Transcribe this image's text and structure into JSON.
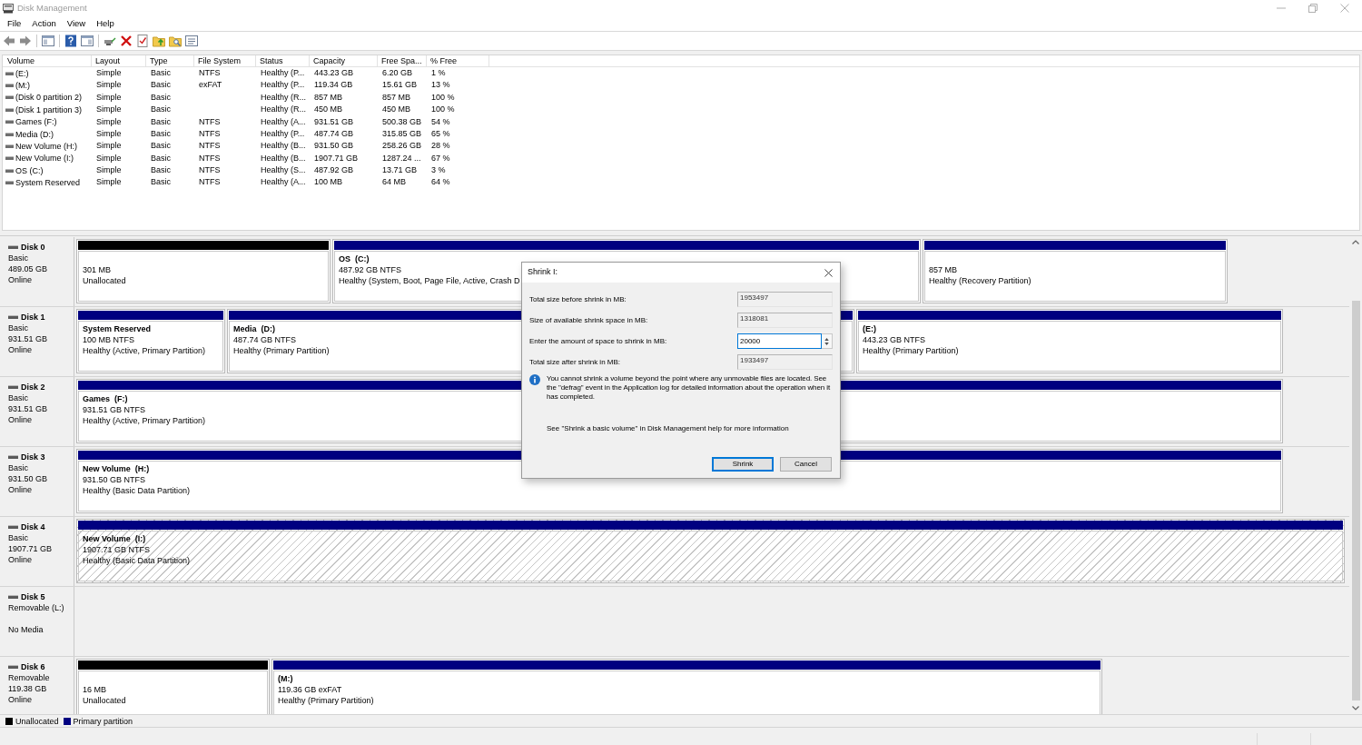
{
  "window": {
    "title": "Disk Management"
  },
  "menu": [
    "File",
    "Action",
    "View",
    "Help"
  ],
  "volume_list": {
    "columns": [
      "Volume",
      "Layout",
      "Type",
      "File System",
      "Status",
      "Capacity",
      "Free Spa...",
      "% Free"
    ],
    "rows": [
      {
        "volume": "(E:)",
        "layout": "Simple",
        "type": "Basic",
        "file_system": "NTFS",
        "status": "Healthy (P...",
        "capacity": "443.23 GB",
        "column_7": "6.20 GB",
        "percent_free": "1 %"
      },
      {
        "volume": "(M:)",
        "layout": "Simple",
        "type": "Basic",
        "file_system": "exFAT",
        "status": "Healthy (P...",
        "capacity": "119.34 GB",
        "column_7": "15.61 GB",
        "percent_free": "13 %"
      },
      {
        "volume": "(Disk 0 partition 2)",
        "layout": "Simple",
        "type": "Basic",
        "status": "Healthy (R...",
        "capacity": "857 MB",
        "column_7": "857 MB",
        "percent_free": "100 %"
      },
      {
        "volume": "(Disk 1 partition 3)",
        "layout": "Simple",
        "type": "Basic",
        "status": "Healthy (R...",
        "capacity": "450 MB",
        "column_7": "450 MB",
        "percent_free": "100 %"
      },
      {
        "volume": "Games (F:)",
        "layout": "Simple",
        "type": "Basic",
        "file_system": "NTFS",
        "status": "Healthy (A...",
        "capacity": "931.51 GB",
        "column_7": "500.38 GB",
        "percent_free": "54 %"
      },
      {
        "volume": "Media (D:)",
        "layout": "Simple",
        "type": "Basic",
        "file_system": "NTFS",
        "status": "Healthy (P...",
        "capacity": "487.74 GB",
        "column_7": "315.85 GB",
        "percent_free": "65 %"
      },
      {
        "volume": "New Volume (H:)",
        "layout": "Simple",
        "type": "Basic",
        "file_system": "NTFS",
        "status": "Healthy (B...",
        "capacity": "931.50 GB",
        "column_7": "258.26 GB",
        "percent_free": "28 %"
      },
      {
        "volume": "New Volume (I:)",
        "layout": "Simple",
        "type": "Basic",
        "file_system": "NTFS",
        "status": "Healthy (B...",
        "capacity": "1907.71 GB",
        "column_7": "1287.24 ...",
        "percent_free": "67 %"
      },
      {
        "volume": "OS (C:)",
        "layout": "Simple",
        "type": "Basic",
        "file_system": "NTFS",
        "status": "Healthy (S...",
        "capacity": "487.92 GB",
        "column_7": "13.71 GB",
        "percent_free": "3 %"
      },
      {
        "volume": "System Reserved",
        "layout": "Simple",
        "type": "Basic",
        "file_system": "NTFS",
        "status": "Healthy (A...",
        "capacity": "100 MB",
        "column_7": "64 MB",
        "percent_free": "64 %"
      }
    ]
  },
  "disks": [
    {
      "name": "Disk 0",
      "type": "Basic",
      "size": "489.05 GB",
      "status": "Online",
      "partitions": [
        {
          "kind": "unallocated",
          "selected": false,
          "size": "301 MB",
          "status": "Unallocated"
        },
        {
          "kind": "primary",
          "selected": false,
          "name": "OS  (C:)",
          "size": "487.92 GB NTFS",
          "status": "Healthy (System, Boot, Page File, Active, Crash D"
        },
        {
          "kind": "primary",
          "selected": false,
          "size": "857 MB",
          "status": "Healthy (Recovery Partition)"
        }
      ]
    },
    {
      "name": "Disk 1",
      "type": "Basic",
      "size": "931.51 GB",
      "status": "Online",
      "partitions": [
        {
          "kind": "primary",
          "selected": false,
          "name": "System Reserved",
          "size": "100 MB NTFS",
          "status": "Healthy (Active, Primary Partition)"
        },
        {
          "kind": "primary",
          "selected": false,
          "name": "Media  (D:)",
          "size": "487.74 GB NTFS",
          "status": "Healthy (Primary Partition)"
        },
        {
          "kind": "primary",
          "selected": false,
          "name": "(E:)",
          "size": "443.23 GB NTFS",
          "status": "Healthy (Primary Partition)"
        }
      ]
    },
    {
      "name": "Disk 2",
      "type": "Basic",
      "size": "931.51 GB",
      "status": "Online",
      "partitions": [
        {
          "kind": "primary",
          "selected": false,
          "name": "Games  (F:)",
          "size": "931.51 GB NTFS",
          "status": "Healthy (Active, Primary Partition)"
        }
      ]
    },
    {
      "name": "Disk 3",
      "type": "Basic",
      "size": "931.50 GB",
      "status": "Online",
      "partitions": [
        {
          "kind": "primary",
          "selected": false,
          "name": "New Volume  (H:)",
          "size": "931.50 GB NTFS",
          "status": "Healthy (Basic Data Partition)"
        }
      ]
    },
    {
      "name": "Disk 4",
      "type": "Basic",
      "size": "1907.71 GB",
      "status": "Online",
      "partitions": [
        {
          "kind": "primary",
          "selected": true,
          "name": "New Volume  (I:)",
          "size": "1907.71 GB NTFS",
          "status": "Healthy (Basic Data Partition)"
        }
      ]
    },
    {
      "name": "Disk 5",
      "type": "Removable (L:)",
      "status": "No Media"
    },
    {
      "name": "Disk 6",
      "type": "Removable",
      "size": "119.38 GB",
      "status": "Online",
      "partitions": [
        {
          "kind": "unallocated",
          "selected": false,
          "size": "16 MB",
          "status": "Unallocated"
        },
        {
          "kind": "primary",
          "selected": false,
          "name": "(M:)",
          "size": "119.36 GB exFAT",
          "status": "Healthy (Primary Partition)"
        }
      ]
    }
  ],
  "legend": [
    {
      "label": "Unallocated",
      "color": "#000000"
    },
    {
      "label": "Primary partition",
      "color": "#000080"
    }
  ],
  "dialog": {
    "title": "Shrink I:",
    "fields": [
      {
        "kind": "readonly",
        "label": "Total size before shrink in MB:",
        "value": "1953497"
      },
      {
        "kind": "readonly",
        "label": "Size of available shrink space in MB:",
        "value": "1318081"
      },
      {
        "kind": "spin",
        "label": "Enter the amount of space to shrink in MB:",
        "value": "20000"
      },
      {
        "kind": "readonly",
        "label": "Total size after shrink in MB:",
        "value": "1933497"
      }
    ],
    "info": "You cannot shrink a volume beyond the point where any unmovable files are located. See the \"defrag\" event in the Application log for detailed information about the operation when it has completed.",
    "help": "See \"Shrink a basic volume\" in Disk Management help for more information",
    "buttons": [
      {
        "label": "Shrink",
        "default": true
      },
      {
        "label": "Cancel",
        "default": false
      }
    ]
  }
}
